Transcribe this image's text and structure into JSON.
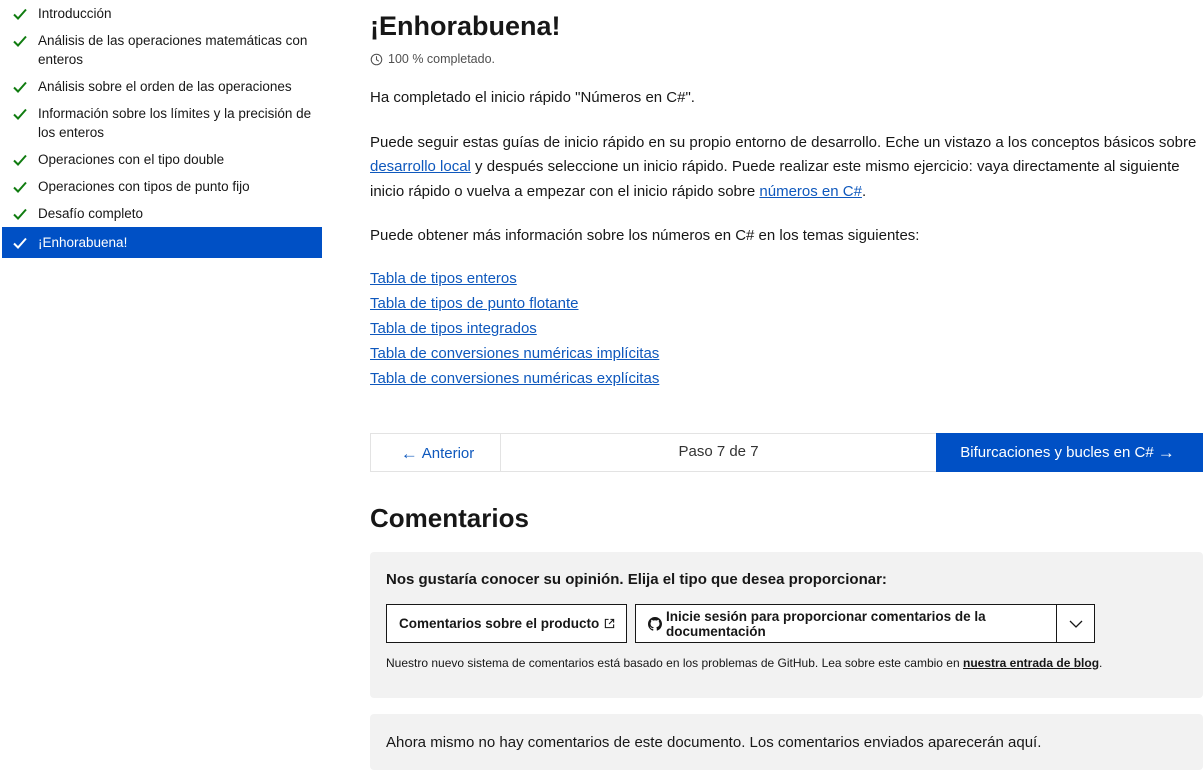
{
  "sidebar": {
    "items": [
      {
        "label": "Introducción"
      },
      {
        "label": "Análisis de las operaciones matemáticas con enteros"
      },
      {
        "label": "Análisis sobre el orden de las operaciones"
      },
      {
        "label": "Información sobre los límites y la precisión de los enteros"
      },
      {
        "label": "Operaciones con el tipo double"
      },
      {
        "label": "Operaciones con tipos de punto fijo"
      },
      {
        "label": "Desafío completo"
      },
      {
        "label": "¡Enhorabuena!"
      }
    ],
    "active_index": 7
  },
  "main": {
    "title": "¡Enhorabuena!",
    "progress": "100 % completado.",
    "p1": "Ha completado el inicio rápido \"Números en C#\".",
    "p2": {
      "a": "Puede seguir estas guías de inicio rápido en su propio entorno de desarrollo. Eche un vistazo a los conceptos básicos sobre ",
      "link1": "desarrollo local",
      "b": " y después seleccione un inicio rápido. Puede realizar este mismo ejercicio: vaya directamente al siguiente inicio rápido o vuelva a empezar con el inicio rápido sobre ",
      "link2": "números en C#",
      "c": "."
    },
    "p3": "Puede obtener más información sobre los números en C# en los temas siguientes:",
    "links": [
      "Tabla de tipos enteros",
      "Tabla de tipos de punto flotante",
      "Tabla de tipos integrados",
      "Tabla de conversiones numéricas implícitas",
      "Tabla de conversiones numéricas explícitas"
    ]
  },
  "stepnav": {
    "prev": "Anterior",
    "step": "Paso 7 de 7",
    "next": "Bifurcaciones y bucles en C#"
  },
  "feedback": {
    "heading": "Comentarios",
    "question": "Nos gustaría conocer su opinión. Elija el tipo que desea proporcionar:",
    "product_button": "Comentarios sobre el producto",
    "github_button": "Inicie sesión para proporcionar comentarios de la documentación",
    "note": "Nuestro nuevo sistema de comentarios está basado en los problemas de GitHub. Lea sobre este cambio en ",
    "note_link": "nuestra entrada de blog",
    "note_end": ".",
    "no_comments": "Ahora mismo no hay comentarios de este documento. Los comentarios enviados aparecerán aquí."
  },
  "colors": {
    "accent": "#0050c5",
    "link": "#0e58bd",
    "check": "#107c10",
    "panel": "#f2f2f2"
  },
  "icons": {
    "sidebar_check": "checkmark-icon",
    "progress": "clock-icon",
    "prev": "arrow-left-icon",
    "next": "arrow-right-icon",
    "external": "external-link-icon",
    "github": "github-icon",
    "dropdown": "chevron-down-icon"
  }
}
